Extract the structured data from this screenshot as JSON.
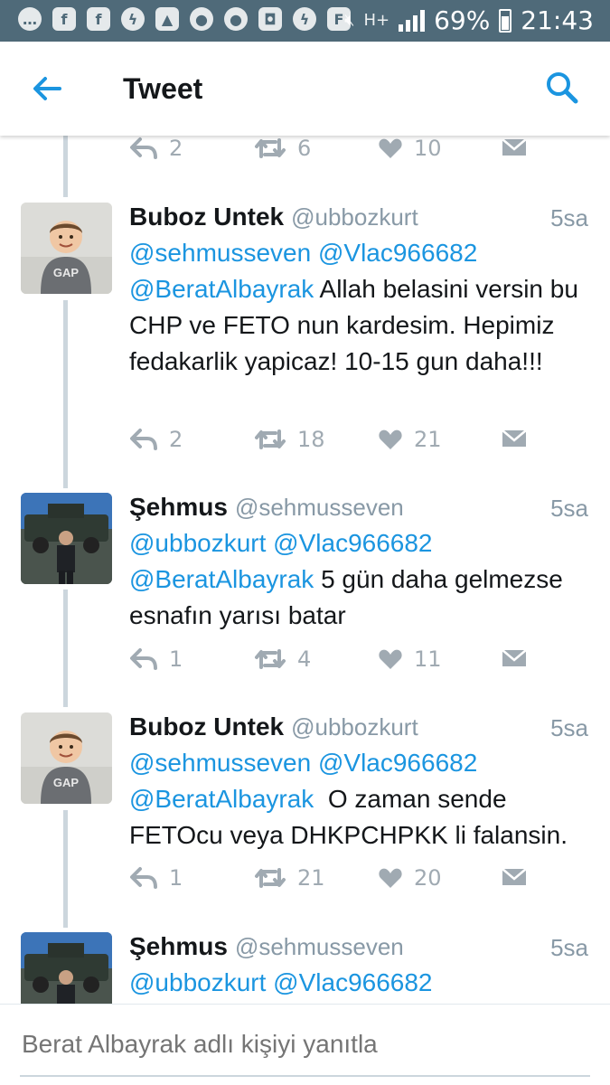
{
  "status_bar": {
    "battery": "69%",
    "time": "21:43",
    "network": "H+",
    "left_icons": [
      "chat-bubble-icon",
      "facebook-icon",
      "facebook-icon",
      "messenger-icon",
      "image-icon",
      "location-icon",
      "location-icon",
      "camera-icon",
      "messenger-icon",
      "flipboard-icon"
    ]
  },
  "header": {
    "title": "Tweet"
  },
  "colors": {
    "accent": "#1b95e0",
    "status_bar": "#4f6a79",
    "muted": "#8899a6"
  },
  "top_actions": {
    "replies": "2",
    "retweets": "6",
    "likes": "10"
  },
  "tweets": [
    {
      "name": "Buboz Untek",
      "handle": "@ubbozkurt",
      "time": "5sa",
      "mentions_line": [
        "@sehmusseven",
        "@Vlac966682"
      ],
      "mention3": "@BeratAlbayrak",
      "text": " Allah belasini versin bu CHP ve FETO nun kardesim. Hepimiz fedakarlik yapicaz! 10-15 gun daha!!!",
      "replies": "2",
      "retweets": "18",
      "likes": "21"
    },
    {
      "name": "Şehmus",
      "handle": "@sehmusseven",
      "time": "5sa",
      "mentions_line": [
        "@ubbozkurt",
        "@Vlac966682"
      ],
      "mention3": "@BeratAlbayrak",
      "text": " 5 gün daha gelmezse esnafın yarısı batar",
      "replies": "1",
      "retweets": "4",
      "likes": "11"
    },
    {
      "name": "Buboz Untek",
      "handle": "@ubbozkurt",
      "time": "5sa",
      "mentions_line": [
        "@sehmusseven",
        "@Vlac966682"
      ],
      "mention3": "@BeratAlbayrak",
      "text": "  O zaman sende FETOcu veya DHKPCHPKK li falansin.",
      "replies": "1",
      "retweets": "21",
      "likes": "20"
    },
    {
      "name": "Şehmus",
      "handle": "@sehmusseven",
      "time": "5sa",
      "mentions_line": [
        "@ubbozkurt",
        "@Vlac966682"
      ]
    }
  ],
  "reply_bar": {
    "placeholder": "Berat Albayrak adlı kişiyi yanıtla"
  }
}
